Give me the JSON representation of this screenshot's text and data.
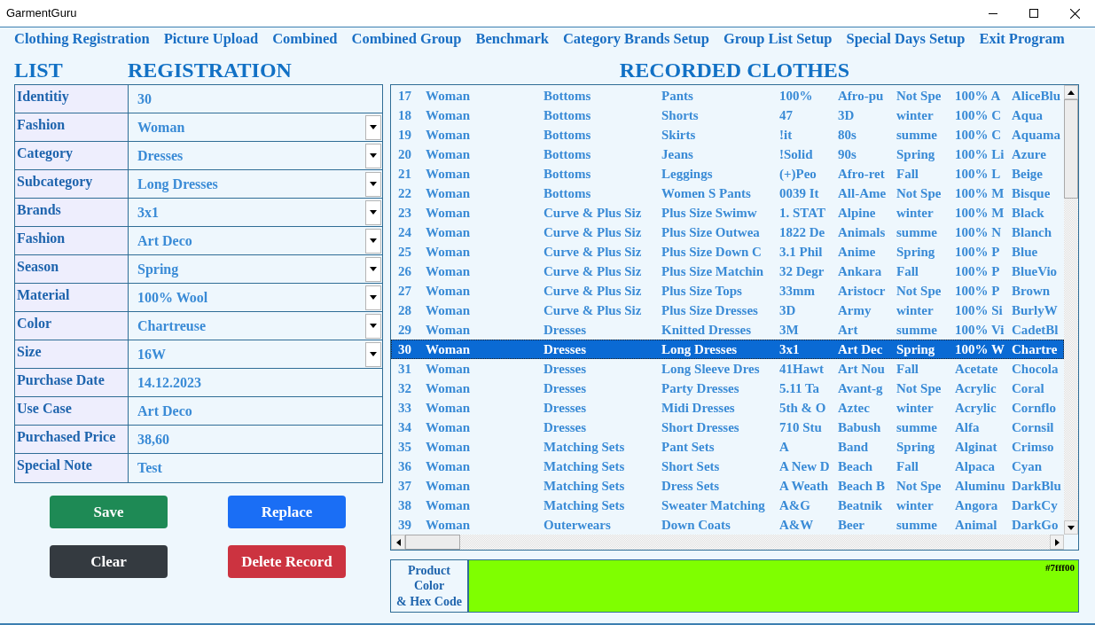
{
  "window": {
    "title": "GarmentGuru"
  },
  "menu": [
    "Clothing Registration",
    "Picture Upload",
    "Combined",
    "Combined Group",
    "Benchmark",
    "Category Brands Setup",
    "Group List Setup",
    "Special Days Setup",
    "Exit Program"
  ],
  "list_heading": "LIST",
  "registration_heading": "REGISTRATION",
  "form": {
    "fields": [
      {
        "label": "Identitiy",
        "value": "30",
        "kind": "text"
      },
      {
        "label": "Fashion",
        "value": "Woman",
        "kind": "dropdown"
      },
      {
        "label": "Category",
        "value": "Dresses",
        "kind": "dropdown"
      },
      {
        "label": "Subcategory",
        "value": "Long Dresses",
        "kind": "dropdown"
      },
      {
        "label": "Brands",
        "value": "3x1",
        "kind": "dropdown"
      },
      {
        "label": "Fashion",
        "value": "Art Deco",
        "kind": "dropdown"
      },
      {
        "label": "Season",
        "value": "Spring",
        "kind": "dropdown"
      },
      {
        "label": "Material",
        "value": "100% Wool",
        "kind": "dropdown"
      },
      {
        "label": "Color",
        "value": "Chartreuse",
        "kind": "dropdown"
      },
      {
        "label": "Size",
        "value": "16W",
        "kind": "dropdown"
      },
      {
        "label": "Purchase Date",
        "value": "14.12.2023",
        "kind": "text"
      },
      {
        "label": "Use Case",
        "value": "Art Deco",
        "kind": "text"
      },
      {
        "label": "Purchased Price",
        "value": "38,60",
        "kind": "text"
      },
      {
        "label": "Special Note",
        "value": "Test",
        "kind": "text"
      }
    ]
  },
  "buttons": [
    {
      "label": "Save",
      "color": "#1e8a55"
    },
    {
      "label": "Replace",
      "color": "#1a6ef5"
    },
    {
      "label": "Clear",
      "color": "#343a40"
    },
    {
      "label": "Delete Record",
      "color": "#cc3340"
    }
  ],
  "records": {
    "title": "RECORDED CLOTHES",
    "rows": [
      {
        "cells": [
          "17",
          "Woman",
          "Bottoms",
          "Pants",
          "100%",
          "Afro-pu",
          "Not Spe",
          "100% A",
          "AliceBlu"
        ],
        "selected": false
      },
      {
        "cells": [
          "18",
          "Woman",
          "Bottoms",
          "Shorts",
          "47",
          "3D",
          "winter",
          "100% C",
          "Aqua"
        ],
        "selected": false
      },
      {
        "cells": [
          "19",
          "Woman",
          "Bottoms",
          "Skirts",
          "!it",
          "80s",
          "summe",
          "100% C",
          "Aquama"
        ],
        "selected": false
      },
      {
        "cells": [
          "20",
          "Woman",
          "Bottoms",
          "Jeans",
          "!Solid",
          "90s",
          "Spring",
          "100% Li",
          "Azure"
        ],
        "selected": false
      },
      {
        "cells": [
          "21",
          "Woman",
          "Bottoms",
          "Leggings",
          "(+)Peo",
          "Afro-ret",
          "Fall",
          "100% L",
          "Beige"
        ],
        "selected": false
      },
      {
        "cells": [
          "22",
          "Woman",
          "Bottoms",
          "Women S Pants",
          "0039 It",
          "All-Ame",
          "Not Spe",
          "100% M",
          "Bisque"
        ],
        "selected": false
      },
      {
        "cells": [
          "23",
          "Woman",
          "Curve & Plus Siz",
          "Plus Size Swimw",
          "1. STAT",
          "Alpine",
          "winter",
          "100% M",
          "Black"
        ],
        "selected": false
      },
      {
        "cells": [
          "24",
          "Woman",
          "Curve & Plus Siz",
          "Plus Size Outwea",
          "1822 De",
          "Animals",
          "summe",
          "100% N",
          "Blanch"
        ],
        "selected": false
      },
      {
        "cells": [
          "25",
          "Woman",
          "Curve & Plus Siz",
          "Plus Size Down C",
          "3.1 Phil",
          "Anime",
          "Spring",
          "100% P",
          "Blue"
        ],
        "selected": false
      },
      {
        "cells": [
          "26",
          "Woman",
          "Curve & Plus Siz",
          "Plus Size Matchin",
          "32 Degr",
          "Ankara",
          "Fall",
          "100% P",
          "BlueVio"
        ],
        "selected": false
      },
      {
        "cells": [
          "27",
          "Woman",
          "Curve & Plus Siz",
          "Plus Size Tops",
          "33mm",
          "Aristocr",
          "Not Spe",
          "100% P",
          "Brown"
        ],
        "selected": false
      },
      {
        "cells": [
          "28",
          "Woman",
          "Curve & Plus Siz",
          "Plus Size Dresses",
          "3D",
          "Army",
          "winter",
          "100% Si",
          "BurlyW"
        ],
        "selected": false
      },
      {
        "cells": [
          "29",
          "Woman",
          "Dresses",
          "Knitted Dresses",
          "3M",
          "Art",
          "summe",
          "100% Vi",
          "CadetBl"
        ],
        "selected": false
      },
      {
        "cells": [
          "30",
          "Woman",
          "Dresses",
          "Long Dresses",
          "3x1",
          "Art Dec",
          "Spring",
          "100% W",
          "Chartre"
        ],
        "selected": true
      },
      {
        "cells": [
          "31",
          "Woman",
          "Dresses",
          "Long Sleeve Dres",
          "41Hawt",
          "Art Nou",
          "Fall",
          "Acetate",
          "Chocola"
        ],
        "selected": false
      },
      {
        "cells": [
          "32",
          "Woman",
          "Dresses",
          "Party Dresses",
          "5.11 Ta",
          "Avant-g",
          "Not Spe",
          "Acrylic",
          "Coral"
        ],
        "selected": false
      },
      {
        "cells": [
          "33",
          "Woman",
          "Dresses",
          "Midi Dresses",
          "5th & O",
          "Aztec",
          "winter",
          "Acrylic",
          "Cornflo"
        ],
        "selected": false
      },
      {
        "cells": [
          "34",
          "Woman",
          "Dresses",
          "Short Dresses",
          "710 Stu",
          "Babush",
          "summe",
          "Alfa",
          "Cornsil"
        ],
        "selected": false
      },
      {
        "cells": [
          "35",
          "Woman",
          "Matching Sets",
          "Pant Sets",
          "A",
          "Band",
          "Spring",
          "Alginat",
          "Crimso"
        ],
        "selected": false
      },
      {
        "cells": [
          "36",
          "Woman",
          "Matching Sets",
          "Short Sets",
          "A New D",
          "Beach",
          "Fall",
          "Alpaca",
          "Cyan"
        ],
        "selected": false
      },
      {
        "cells": [
          "37",
          "Woman",
          "Matching Sets",
          "Dress Sets",
          "A Weath",
          "Beach B",
          "Not Spe",
          "Aluminu",
          "DarkBlu"
        ],
        "selected": false
      },
      {
        "cells": [
          "38",
          "Woman",
          "Matching Sets",
          "Sweater Matching",
          "A&G",
          "Beatnik",
          "winter",
          "Angora",
          "DarkCy"
        ],
        "selected": false
      },
      {
        "cells": [
          "39",
          "Woman",
          "Outerwears",
          "Down Coats",
          "A&W",
          "Beer",
          "summe",
          "Animal",
          "DarkGo"
        ],
        "selected": false
      }
    ]
  },
  "color_panel": {
    "label": "Product\nColor\n& Hex Code",
    "hex": "#7fff00",
    "color": "#7fff00"
  }
}
